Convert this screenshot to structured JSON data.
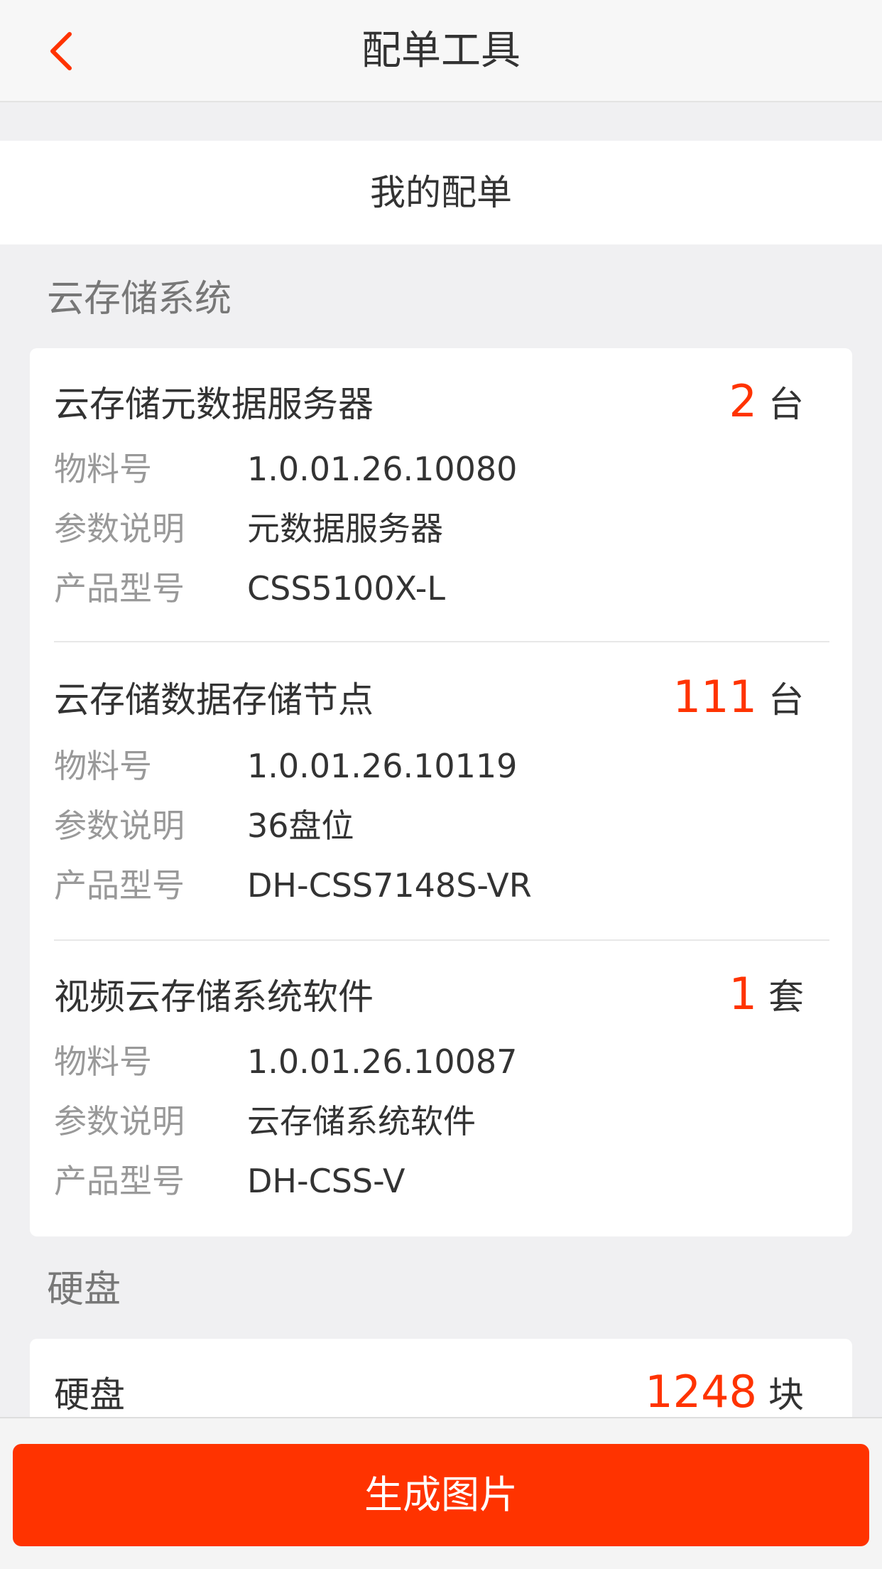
{
  "header": {
    "title": "配单工具",
    "back_icon": "chevron-left-icon",
    "accent_color": "#ff3300"
  },
  "subtab": {
    "label": "我的配单"
  },
  "sections": [
    {
      "title": "云存储系统",
      "items": [
        {
          "name": "云存储元数据服务器",
          "qty": "2",
          "unit": "台",
          "rows": [
            {
              "label": "物料号",
              "value": "1.0.01.26.10080"
            },
            {
              "label": "参数说明",
              "value": "元数据服务器"
            },
            {
              "label": "产品型号",
              "value": "CSS5100X-L"
            }
          ]
        },
        {
          "name": "云存储数据存储节点",
          "qty": "111",
          "unit": "台",
          "rows": [
            {
              "label": "物料号",
              "value": "1.0.01.26.10119"
            },
            {
              "label": "参数说明",
              "value": "36盘位"
            },
            {
              "label": "产品型号",
              "value": "DH-CSS7148S-VR"
            }
          ]
        },
        {
          "name": "视频云存储系统软件",
          "qty": "1",
          "unit": "套",
          "rows": [
            {
              "label": "物料号",
              "value": "1.0.01.26.10087"
            },
            {
              "label": "参数说明",
              "value": "云存储系统软件"
            },
            {
              "label": "产品型号",
              "value": "DH-CSS-V"
            }
          ]
        }
      ]
    },
    {
      "title": "硬盘",
      "items": [
        {
          "name": "硬盘",
          "qty": "1248",
          "unit": "块"
        }
      ]
    }
  ],
  "bottom": {
    "button_label": "生成图片"
  }
}
